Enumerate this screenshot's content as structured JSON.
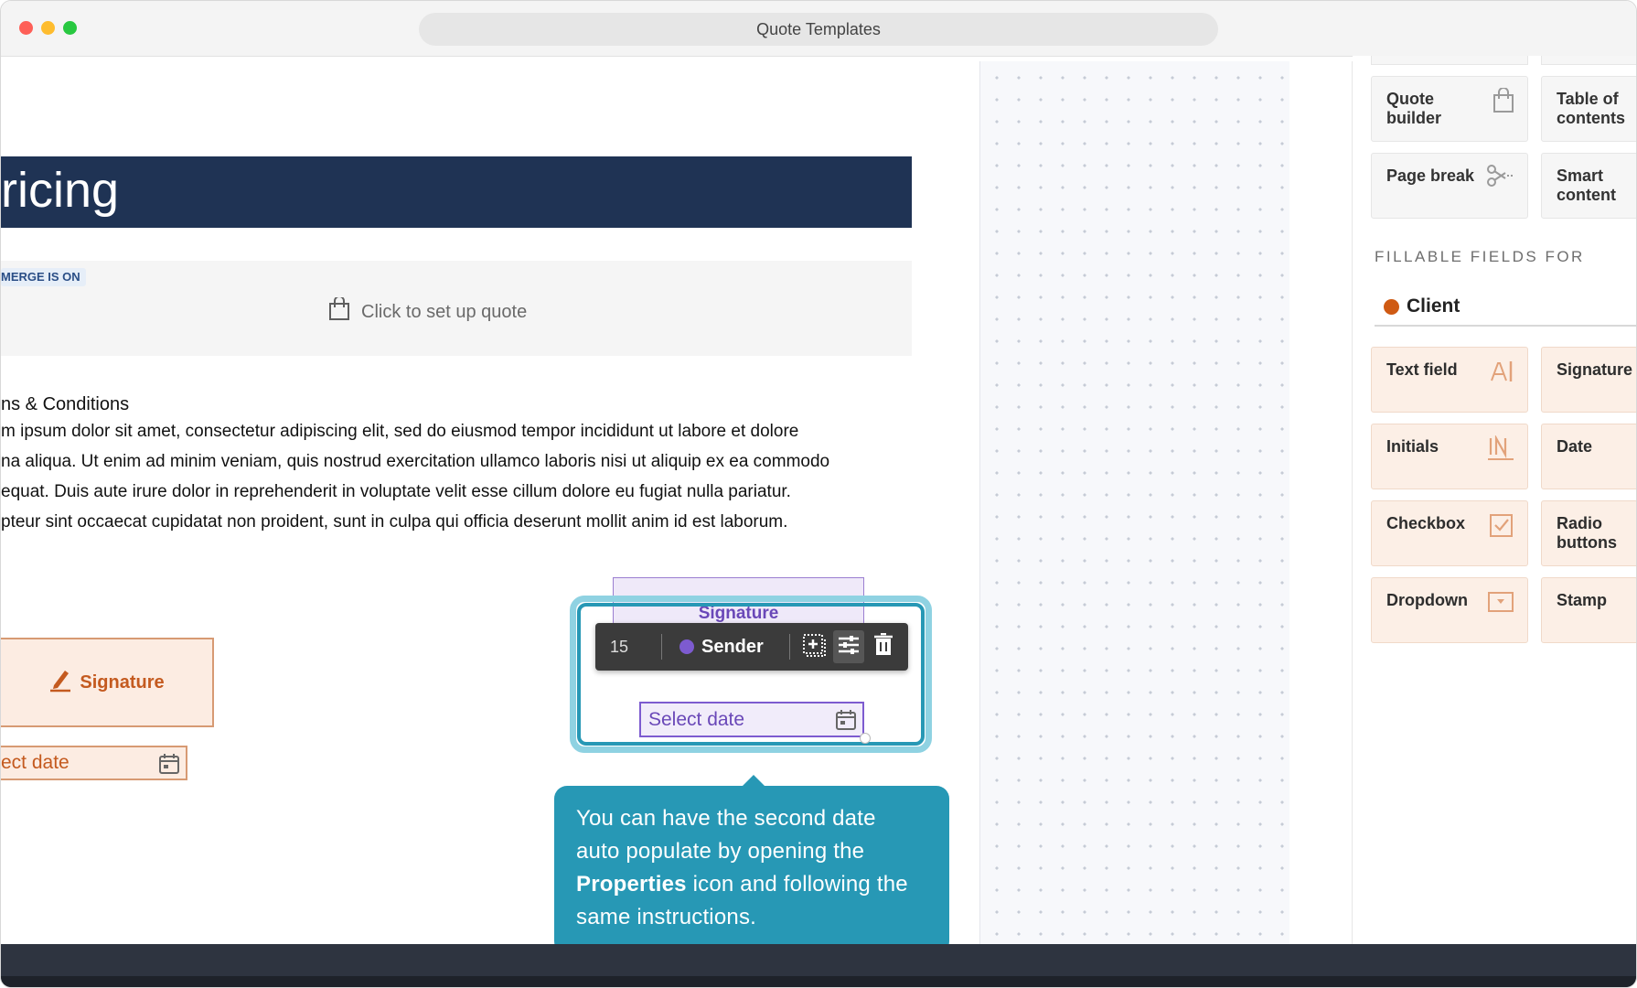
{
  "window": {
    "title": "Quote Templates"
  },
  "document": {
    "banner_title": "ricing",
    "quote_block": {
      "merge_badge": "MERGE IS ON",
      "cta": "Click to set up quote"
    },
    "terms": {
      "title": "ns & Conditions",
      "lines": [
        "m ipsum dolor sit amet, consectetur adipiscing elit, sed do eiusmod tempor incididunt ut labore et dolore",
        "na aliqua. Ut enim ad minim veniam, quis nostrud exercitation ullamco laboris nisi ut aliquip ex ea commodo",
        "equat. Duis aute irure dolor in reprehenderit in voluptate velit esse cillum dolore eu fugiat nulla pariatur.",
        "pteur sint occaecat cupidatat non proident, sunt in culpa qui officia deserunt mollit anim id est laborum."
      ]
    },
    "client_fields": {
      "signature_label": "Signature",
      "date_placeholder": "ect date"
    },
    "sender_fields": {
      "signature_label": "Signature",
      "date_placeholder": "Select date",
      "toolbar": {
        "page_number": "15",
        "role": "Sender"
      }
    },
    "tooltip": {
      "line1": "You can have the second date",
      "line2": "auto populate by opening the",
      "bold": "Properties",
      "line3_rest": " icon and following the",
      "line4": "same instructions."
    }
  },
  "sidebar": {
    "blocks": [
      {
        "label": "Quote builder",
        "icon": "shopping-bag-icon"
      },
      {
        "label": "Table of contents",
        "icon": ""
      },
      {
        "label": "Page break",
        "icon": "scissors-icon"
      },
      {
        "label": "Smart content",
        "icon": ""
      }
    ],
    "fillable_label": "FILLABLE FIELDS FOR",
    "recipient": {
      "name": "Client",
      "color": "#cf5a13"
    },
    "fields": [
      {
        "label": "Text field",
        "icon": "text-field-icon"
      },
      {
        "label": "Signature",
        "icon": ""
      },
      {
        "label": "Initials",
        "icon": "initials-icon"
      },
      {
        "label": "Date",
        "icon": ""
      },
      {
        "label": "Checkbox",
        "icon": "checkbox-icon"
      },
      {
        "label": "Radio buttons",
        "icon": ""
      },
      {
        "label": "Dropdown",
        "icon": "dropdown-icon"
      },
      {
        "label": "Stamp",
        "icon": ""
      }
    ]
  },
  "colors": {
    "banner": "#1f3354",
    "client_accent": "#c45a1f",
    "sender_accent": "#7d5bd0",
    "tooltip": "#2798b5"
  }
}
